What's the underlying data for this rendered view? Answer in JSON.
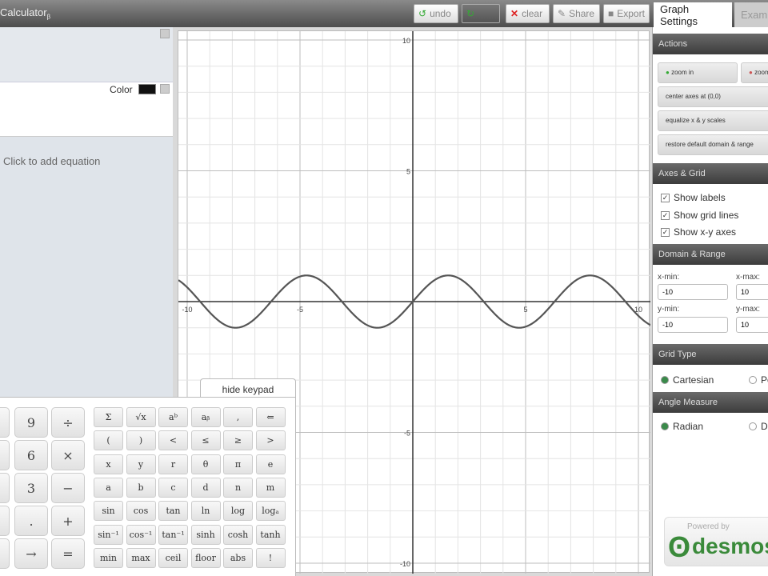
{
  "header": {
    "title": "Calculator",
    "beta": "β",
    "undo": "undo",
    "redo": "",
    "clear": "clear",
    "share": "Share",
    "export": "Export",
    "tabs": [
      "Graph Settings",
      "Examples"
    ]
  },
  "expressions": {
    "color_label": "Color",
    "add_placeholder": "Click to add equation",
    "color": "#111111"
  },
  "keypad": {
    "hide": "hide keypad",
    "big": [
      [
        "9",
        "÷"
      ],
      [
        "6",
        "×"
      ],
      [
        "3",
        "−"
      ],
      [
        ".",
        "+"
      ],
      [
        "→",
        "="
      ]
    ],
    "small": [
      [
        "Σ",
        "√x",
        "aᵇ",
        "aᵦ",
        ",",
        "⇐"
      ],
      [
        "(",
        ")",
        "<",
        "≤",
        "≥",
        ">"
      ],
      [
        "x",
        "y",
        "r",
        "θ",
        "π",
        "e"
      ],
      [
        "a",
        "b",
        "c",
        "d",
        "n",
        "m"
      ],
      [
        "sin",
        "cos",
        "tan",
        "ln",
        "log",
        "logₐ"
      ],
      [
        "sin⁻¹",
        "cos⁻¹",
        "tan⁻¹",
        "sinh",
        "cosh",
        "tanh"
      ],
      [
        "min",
        "max",
        "ceil",
        "floor",
        "abs",
        "!"
      ]
    ]
  },
  "settings": {
    "actions_title": "Actions",
    "zoom_in": "zoom in",
    "zoom_out": "zoom out",
    "center": "center axes at (0,0)",
    "equalize": "equalize x & y scales",
    "restore": "restore default domain & range",
    "axes_title": "Axes & Grid",
    "show_labels": "Show labels",
    "show_grid": "Show grid lines",
    "show_axes": "Show x-y axes",
    "domain_title": "Domain & Range",
    "xmin_label": "x-min:",
    "xmax_label": "x-max:",
    "ymin_label": "y-min:",
    "ymax_label": "y-max:",
    "xmin": "-10",
    "xmax": "10",
    "ymin": "-10",
    "ymax": "10",
    "grid_title": "Grid Type",
    "cartesian": "Cartesian",
    "polar": "Polar",
    "angle_title": "Angle Measure",
    "radian": "Radian",
    "degree": "Degree",
    "logo": "Powered by desmos"
  },
  "graph": {
    "function": "y=sin(x)",
    "xmin": -10,
    "xmax": 10,
    "ymin": -10,
    "ymax": 10,
    "ticks": {
      "x_neg10": "-10",
      "x_neg5": "-5",
      "x_5": "5",
      "x_10": "10",
      "y_10": "10",
      "y_5": "5",
      "y_neg5": "-5",
      "y_neg10": "-10"
    },
    "curve_color": "#555555"
  }
}
